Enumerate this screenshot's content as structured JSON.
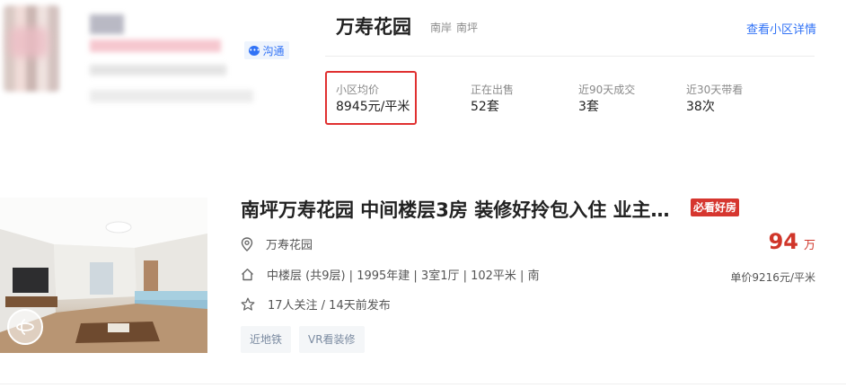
{
  "agent": {
    "chat_label": "沟通"
  },
  "community": {
    "name": "万寿花园",
    "district": "南岸",
    "area": "南坪",
    "details_link": "查看小区详情",
    "stats": [
      {
        "label": "小区均价",
        "value": "8945元/平米"
      },
      {
        "label": "正在出售",
        "value": "52套"
      },
      {
        "label": "近90天成交",
        "value": "3套"
      },
      {
        "label": "近30天带看",
        "value": "38次"
      }
    ]
  },
  "listing": {
    "title": "南坪万寿花园 中间楼层3房 装修好拎包入住 业主…",
    "badge": "必看好房",
    "community": "万寿花园",
    "info": "中楼层 (共9层) | 1995年建 | 3室1厅 | 102平米 | 南",
    "followers": "17人关注 / 14天前发布",
    "tags": [
      "近地铁",
      "VR看装修"
    ],
    "total_price": "94",
    "total_price_unit": "万",
    "unit_price": "单价9216元/平米"
  },
  "colors": {
    "accent_blue": "#3072f6",
    "price_red": "#d0362a",
    "highlight_red": "#e03030",
    "badge_red": "#d6362f"
  },
  "icons": [
    "chat-icon",
    "location-pin-icon",
    "house-icon",
    "star-icon",
    "vr-icon"
  ]
}
